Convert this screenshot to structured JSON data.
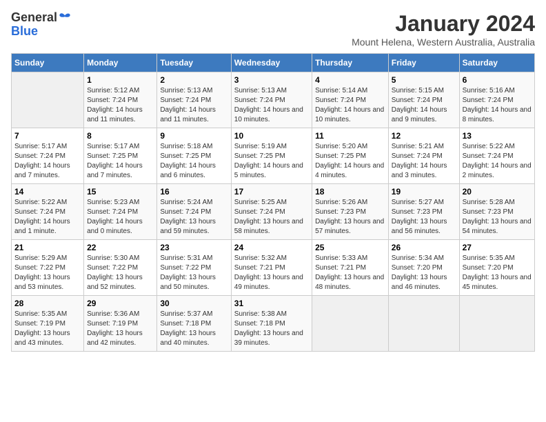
{
  "header": {
    "logo_general": "General",
    "logo_blue": "Blue",
    "title": "January 2024",
    "subtitle": "Mount Helena, Western Australia, Australia"
  },
  "days_of_week": [
    "Sunday",
    "Monday",
    "Tuesday",
    "Wednesday",
    "Thursday",
    "Friday",
    "Saturday"
  ],
  "weeks": [
    [
      {
        "day": "",
        "empty": true
      },
      {
        "day": "1",
        "sunrise": "5:12 AM",
        "sunset": "7:24 PM",
        "daylight": "14 hours and 11 minutes."
      },
      {
        "day": "2",
        "sunrise": "5:13 AM",
        "sunset": "7:24 PM",
        "daylight": "14 hours and 11 minutes."
      },
      {
        "day": "3",
        "sunrise": "5:13 AM",
        "sunset": "7:24 PM",
        "daylight": "14 hours and 10 minutes."
      },
      {
        "day": "4",
        "sunrise": "5:14 AM",
        "sunset": "7:24 PM",
        "daylight": "14 hours and 10 minutes."
      },
      {
        "day": "5",
        "sunrise": "5:15 AM",
        "sunset": "7:24 PM",
        "daylight": "14 hours and 9 minutes."
      },
      {
        "day": "6",
        "sunrise": "5:16 AM",
        "sunset": "7:24 PM",
        "daylight": "14 hours and 8 minutes."
      }
    ],
    [
      {
        "day": "7",
        "sunrise": "5:17 AM",
        "sunset": "7:24 PM",
        "daylight": "14 hours and 7 minutes."
      },
      {
        "day": "8",
        "sunrise": "5:17 AM",
        "sunset": "7:25 PM",
        "daylight": "14 hours and 7 minutes."
      },
      {
        "day": "9",
        "sunrise": "5:18 AM",
        "sunset": "7:25 PM",
        "daylight": "14 hours and 6 minutes."
      },
      {
        "day": "10",
        "sunrise": "5:19 AM",
        "sunset": "7:25 PM",
        "daylight": "14 hours and 5 minutes."
      },
      {
        "day": "11",
        "sunrise": "5:20 AM",
        "sunset": "7:25 PM",
        "daylight": "14 hours and 4 minutes."
      },
      {
        "day": "12",
        "sunrise": "5:21 AM",
        "sunset": "7:24 PM",
        "daylight": "14 hours and 3 minutes."
      },
      {
        "day": "13",
        "sunrise": "5:22 AM",
        "sunset": "7:24 PM",
        "daylight": "14 hours and 2 minutes."
      }
    ],
    [
      {
        "day": "14",
        "sunrise": "5:22 AM",
        "sunset": "7:24 PM",
        "daylight": "14 hours and 1 minute."
      },
      {
        "day": "15",
        "sunrise": "5:23 AM",
        "sunset": "7:24 PM",
        "daylight": "14 hours and 0 minutes."
      },
      {
        "day": "16",
        "sunrise": "5:24 AM",
        "sunset": "7:24 PM",
        "daylight": "13 hours and 59 minutes."
      },
      {
        "day": "17",
        "sunrise": "5:25 AM",
        "sunset": "7:24 PM",
        "daylight": "13 hours and 58 minutes."
      },
      {
        "day": "18",
        "sunrise": "5:26 AM",
        "sunset": "7:23 PM",
        "daylight": "13 hours and 57 minutes."
      },
      {
        "day": "19",
        "sunrise": "5:27 AM",
        "sunset": "7:23 PM",
        "daylight": "13 hours and 56 minutes."
      },
      {
        "day": "20",
        "sunrise": "5:28 AM",
        "sunset": "7:23 PM",
        "daylight": "13 hours and 54 minutes."
      }
    ],
    [
      {
        "day": "21",
        "sunrise": "5:29 AM",
        "sunset": "7:22 PM",
        "daylight": "13 hours and 53 minutes."
      },
      {
        "day": "22",
        "sunrise": "5:30 AM",
        "sunset": "7:22 PM",
        "daylight": "13 hours and 52 minutes."
      },
      {
        "day": "23",
        "sunrise": "5:31 AM",
        "sunset": "7:22 PM",
        "daylight": "13 hours and 50 minutes."
      },
      {
        "day": "24",
        "sunrise": "5:32 AM",
        "sunset": "7:21 PM",
        "daylight": "13 hours and 49 minutes."
      },
      {
        "day": "25",
        "sunrise": "5:33 AM",
        "sunset": "7:21 PM",
        "daylight": "13 hours and 48 minutes."
      },
      {
        "day": "26",
        "sunrise": "5:34 AM",
        "sunset": "7:20 PM",
        "daylight": "13 hours and 46 minutes."
      },
      {
        "day": "27",
        "sunrise": "5:35 AM",
        "sunset": "7:20 PM",
        "daylight": "13 hours and 45 minutes."
      }
    ],
    [
      {
        "day": "28",
        "sunrise": "5:35 AM",
        "sunset": "7:19 PM",
        "daylight": "13 hours and 43 minutes."
      },
      {
        "day": "29",
        "sunrise": "5:36 AM",
        "sunset": "7:19 PM",
        "daylight": "13 hours and 42 minutes."
      },
      {
        "day": "30",
        "sunrise": "5:37 AM",
        "sunset": "7:18 PM",
        "daylight": "13 hours and 40 minutes."
      },
      {
        "day": "31",
        "sunrise": "5:38 AM",
        "sunset": "7:18 PM",
        "daylight": "13 hours and 39 minutes."
      },
      {
        "day": "",
        "empty": true
      },
      {
        "day": "",
        "empty": true
      },
      {
        "day": "",
        "empty": true
      }
    ]
  ]
}
